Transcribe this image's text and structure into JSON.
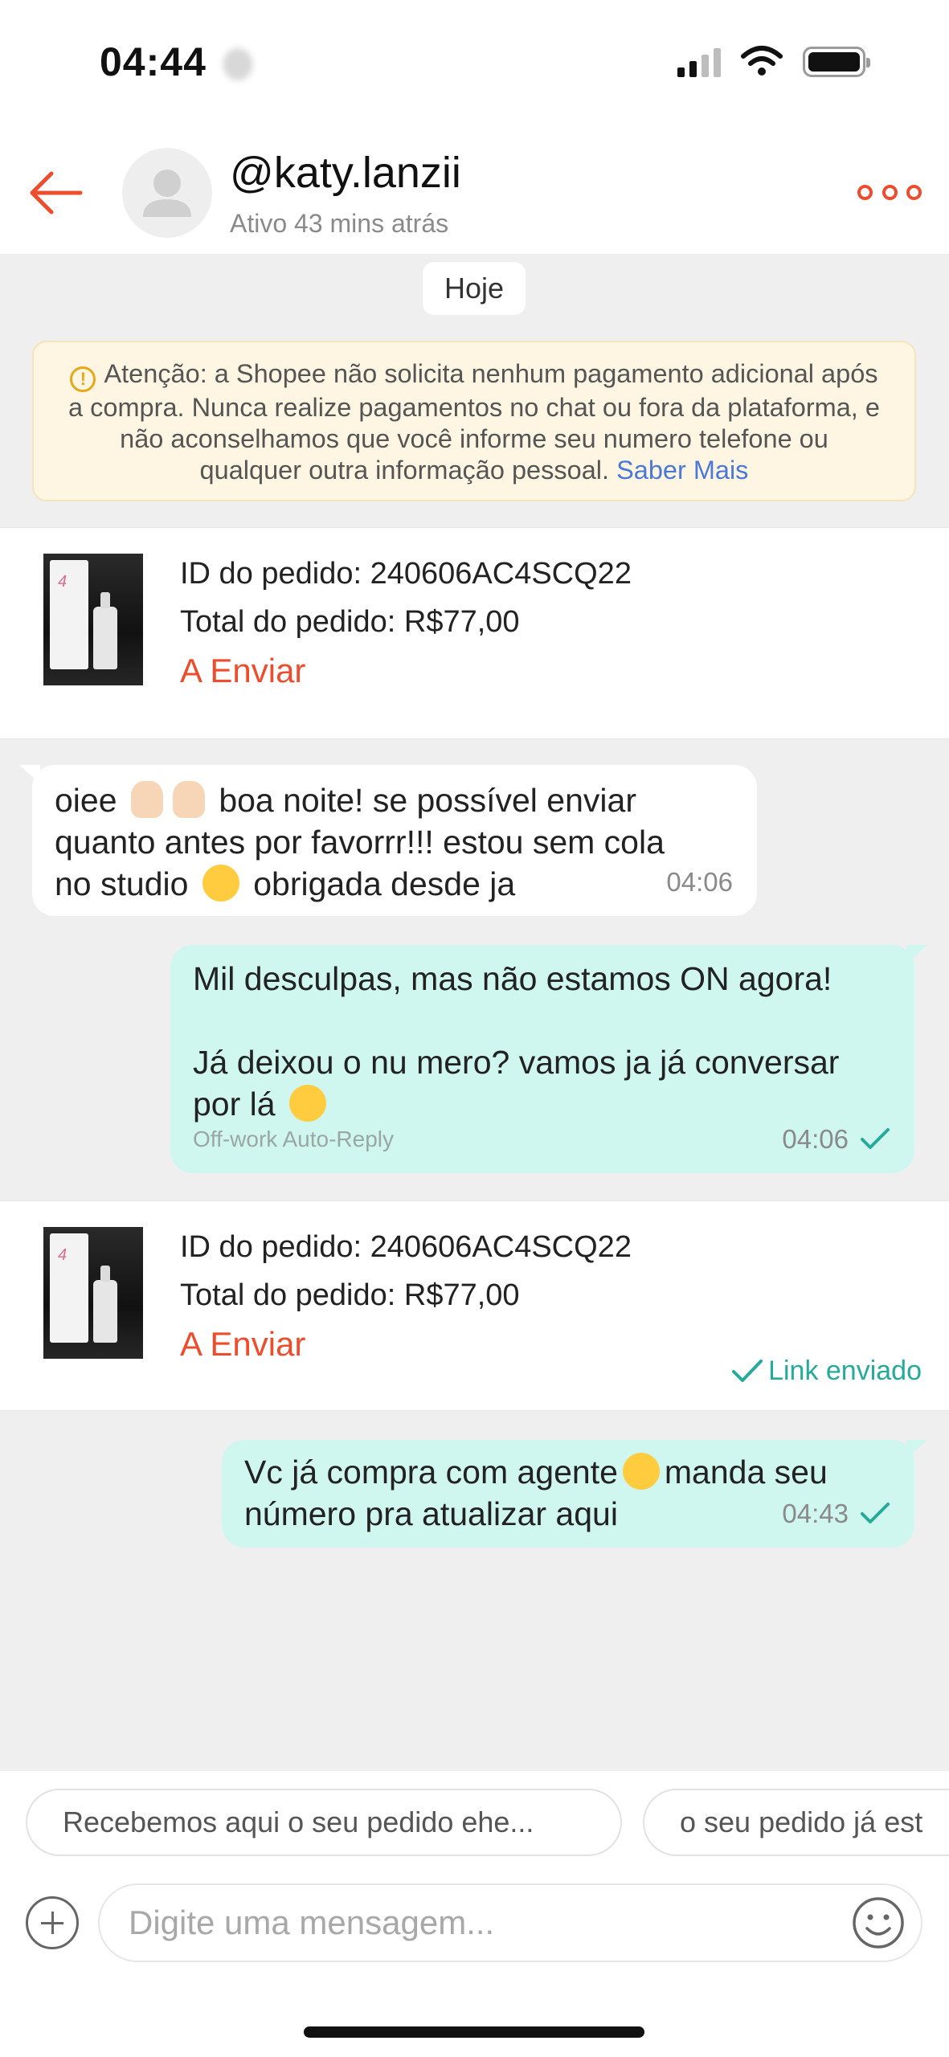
{
  "status_bar": {
    "time": "04:44"
  },
  "header": {
    "username": "@katy.lanzii",
    "active_status": "Ativo 43 mins atrás"
  },
  "date_chip": "Hoje",
  "notice": {
    "text": "Atenção: a Shopee não solicita nenhum pagamento adicional após a compra. Nunca realize pagamentos no chat ou fora da plataforma, e não aconselhamos que você informe seu numero telefone ou qualquer outra informação pessoal.",
    "link": "Saber Mais"
  },
  "orders": [
    {
      "id_line": "ID do pedido: 240606AC4SCQ22",
      "total_line": "Total do pedido: R$77,00",
      "status": "A Enviar"
    },
    {
      "id_line": "ID do pedido: 240606AC4SCQ22",
      "total_line": "Total do pedido: R$77,00",
      "status": "A Enviar",
      "link_status": "Link enviado"
    }
  ],
  "messages": {
    "incoming": {
      "line1a": "oiee",
      "line1b": "boa noite! se possível enviar",
      "line2": "quanto antes por favorrr!!! estou sem cola",
      "line3a": "no studio",
      "line3b": "obrigada desde ja",
      "time": "04:06"
    },
    "auto_reply": {
      "line1": "Mil desculpas, mas não estamos ON agora!",
      "line2": "Já deixou o nu mero? vamos ja já conversar",
      "line3": "por lá",
      "tag": "Off-work Auto-Reply",
      "time": "04:06"
    },
    "reply": {
      "line1a": "Vc já compra com agente",
      "line1b": "manda seu",
      "line2": "número pra atualizar aqui",
      "time": "04:43"
    }
  },
  "quick_replies": [
    "Recebemos aqui o seu pedido ehe...",
    "o seu pedido já est"
  ],
  "composer": {
    "placeholder": "Digite uma mensagem..."
  },
  "colors": {
    "accent": "#ee4d2d",
    "outgoing_bubble": "#cff6ef",
    "check": "#26aa99",
    "link": "#4a79d8"
  }
}
